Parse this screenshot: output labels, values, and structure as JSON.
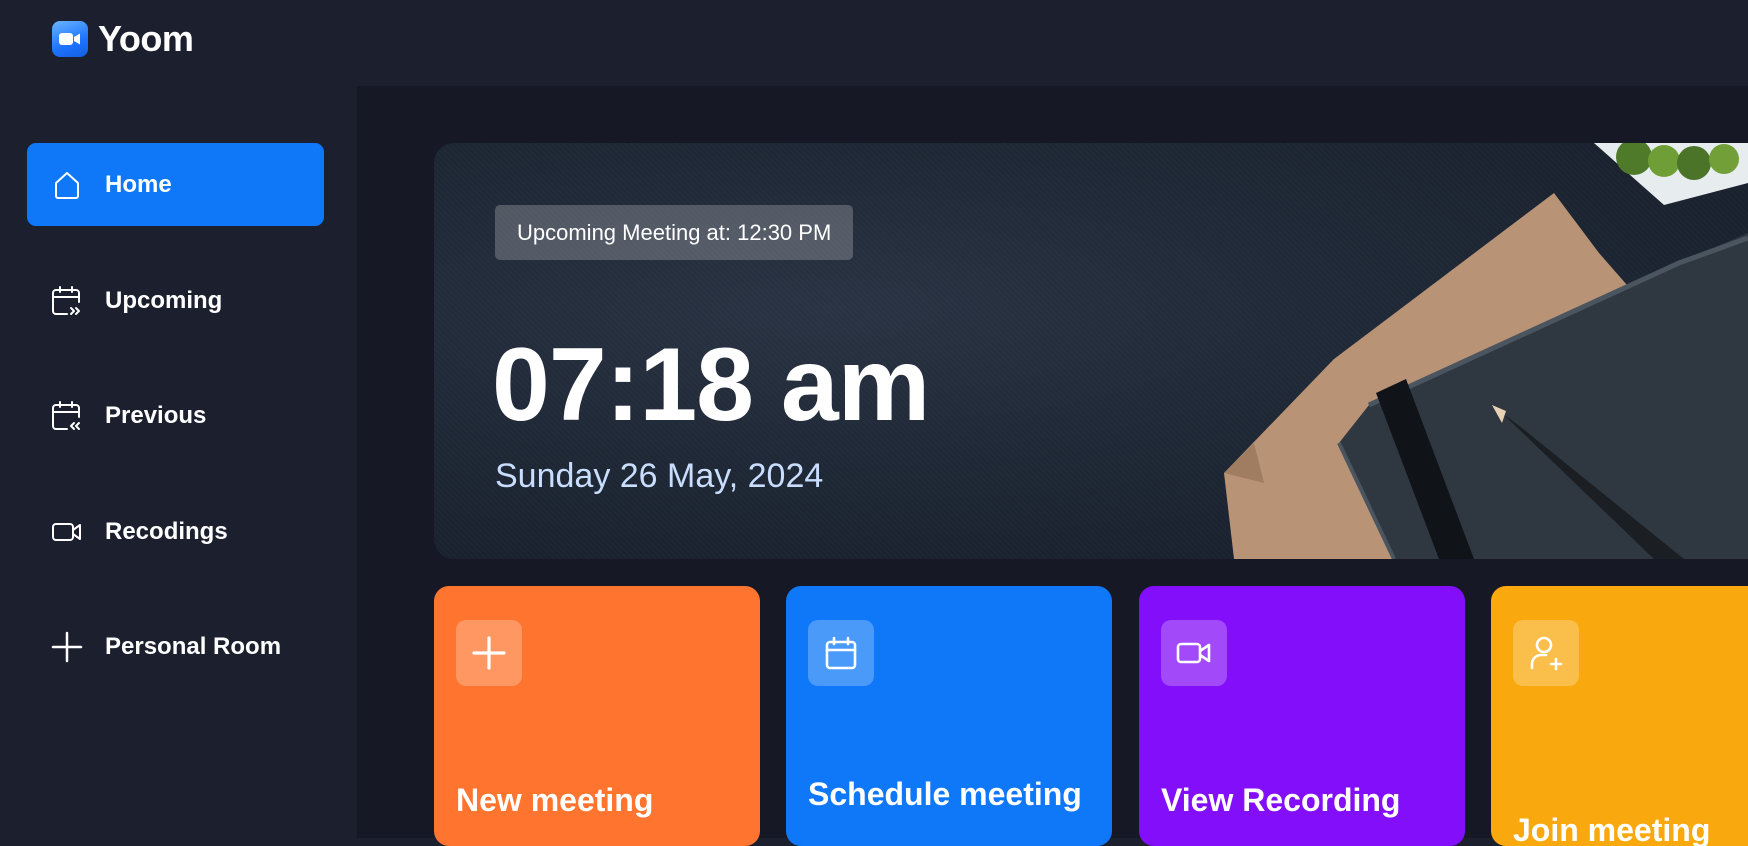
{
  "app": {
    "name": "Yoom"
  },
  "sidebar": {
    "items": [
      {
        "label": "Home",
        "icon": "home-icon",
        "active": true
      },
      {
        "label": "Upcoming",
        "icon": "calendar-forward-icon",
        "active": false
      },
      {
        "label": "Previous",
        "icon": "calendar-back-icon",
        "active": false
      },
      {
        "label": "Recodings",
        "icon": "video-icon",
        "active": false
      },
      {
        "label": "Personal Room",
        "icon": "plus-icon",
        "active": false
      }
    ]
  },
  "hero": {
    "upcoming": "Upcoming Meeting at: 12:30 PM",
    "time": "07:18 am",
    "date": "Sunday 26 May, 2024"
  },
  "cards": [
    {
      "title": "New meeting",
      "icon": "plus-icon",
      "color": "#ff742e"
    },
    {
      "title": "Schedule meeting",
      "icon": "calendar-icon",
      "color": "#0e78f9"
    },
    {
      "title": "View Recording",
      "icon": "video-icon",
      "color": "#830ef9"
    },
    {
      "title": "Join meeting",
      "icon": "user-add-icon",
      "color": "#f9a90e"
    }
  ],
  "colors": {
    "background": "#1c1f2e",
    "main_background": "#161925",
    "accent_blue": "#0e78f9"
  }
}
